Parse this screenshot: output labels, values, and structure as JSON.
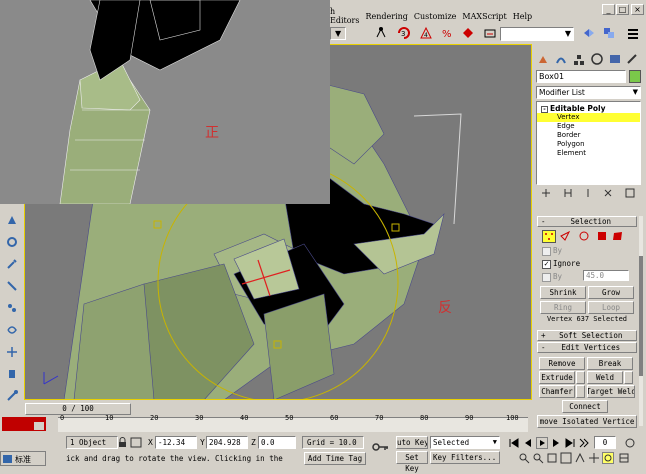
{
  "menu": [
    "h Editors",
    "Rendering",
    "Customize",
    "MAXScript",
    "Help"
  ],
  "window_controls": [
    "_",
    "□",
    "×"
  ],
  "object_name": "Box01",
  "modifier_list": "Modifier List",
  "stack": {
    "root": "Editable Poly",
    "items": [
      "Vertex",
      "Edge",
      "Border",
      "Polygon",
      "Element"
    ],
    "selected_index": 0
  },
  "selection": {
    "header": "Selection",
    "by_vertex": "By",
    "ignore": "Ignore",
    "by_angle": "By",
    "angle_value": "45.0",
    "shrink": "Shrink",
    "grow": "Grow",
    "ring": "Ring",
    "loop": "Loop",
    "status": "Vertex 637 Selected"
  },
  "soft_selection": "Soft Selection",
  "edit_vertices": {
    "header": "Edit Vertices",
    "remove": "Remove",
    "break": "Break",
    "extrude": "Extrude",
    "weld": "Weld",
    "chamfer": "Chamfer",
    "target_weld": "Target Weld",
    "connect": "Connect",
    "remove_isolated": "move Isolated Vertice"
  },
  "viewport": {
    "label_front": "正",
    "label_back": "反",
    "colors": {
      "mesh": "#9aae7a",
      "background": "#7a7a7a",
      "gizmo": "#c8b400"
    }
  },
  "timeline": {
    "frame": "0 / 100",
    "ticks": [
      "0",
      "10",
      "20",
      "30",
      "40",
      "50",
      "60",
      "70",
      "80",
      "90",
      "100"
    ]
  },
  "status": {
    "objects": "1 Object",
    "x_label": "X",
    "x_value": "-12.34",
    "y_label": "Y",
    "y_value": "204.928",
    "z_label": "Z",
    "z_value": "0.0",
    "grid": "Grid = 10.0",
    "auto_key": "uto Key",
    "selected": "Selected",
    "prompt": "ick and drag to rotate the view.  Clicking in the",
    "add_time_tag": "Add Time Tag",
    "set_key": "Set Key",
    "key_filters": "Key Filters...",
    "ime": "标准",
    "frame_value": "0"
  }
}
